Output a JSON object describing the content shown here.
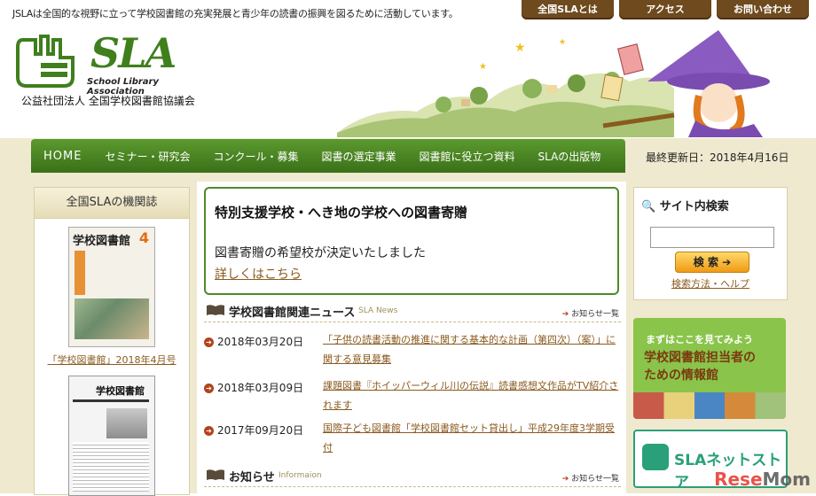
{
  "header": {
    "tagline": "JSLAは全国的な視野に立って学校図書館の充実発展と青少年の読書の振興を図るために活動しています。",
    "top_links": [
      "全国SLAとは",
      "アクセス",
      "お問い合わせ"
    ],
    "logo_sla": "SLA",
    "logo_en": "School Library Association",
    "logo_jp": "公益社団法人 全国学校図書館協議会"
  },
  "nav": {
    "items": [
      "HOME",
      "セミナー・研究会",
      "コンクール・募集",
      "図書の選定事業",
      "図書館に役立つ資料",
      "SLAの出版物"
    ],
    "updated": "最終更新日：2018年4月16日"
  },
  "left": {
    "heading": "全国SLAの機関誌",
    "mag1_title": "学校図書館",
    "mag1_num": "4",
    "mag1_caption": "「学校図書館」2018年4月号",
    "mag2_title": "学校図書館"
  },
  "main": {
    "notice_title": "特別支援学校・へき地の学校への図書寄贈",
    "notice_body": "図書寄贈の希望校が決定いたしました",
    "notice_link": "詳しくはこちら",
    "news_heading": "学校図書館関連ニュース",
    "news_en": "SLA News",
    "news_more": "お知らせ一覧",
    "news": [
      {
        "date": "2018年03月20日",
        "text": "「子供の読書活動の推進に関する基本的な計画（第四次）（案）」に関する意見募集"
      },
      {
        "date": "2018年03月09日",
        "text": "課題図書『ホイッパーウィル川の伝説』読書感想文作品がTV紹介されます"
      },
      {
        "date": "2017年09月20日",
        "text": "国際子ども図書館「学校図書館セット貸出し」平成29年度3学期受付"
      }
    ],
    "info_heading": "お知らせ",
    "info_en": "Informaion",
    "info_more": "お知らせ一覧"
  },
  "right": {
    "search_heading": "サイト内検索",
    "search_value": "",
    "search_button": "検 索",
    "search_help": "検索方法・ヘルプ",
    "banner1_l1": "まずはここを見てみよう",
    "banner1_l2": "学校図書館担当者の",
    "banner1_l3": "ための情報館",
    "banner2": "SLAネットストア"
  },
  "watermark": {
    "rese": "Rese",
    "mom": "Mom"
  },
  "colors": {
    "nav_green": "#3a7019",
    "accent_brown": "#6e4a1e",
    "link": "#8a5a1e",
    "bullet": "#b2431a"
  }
}
